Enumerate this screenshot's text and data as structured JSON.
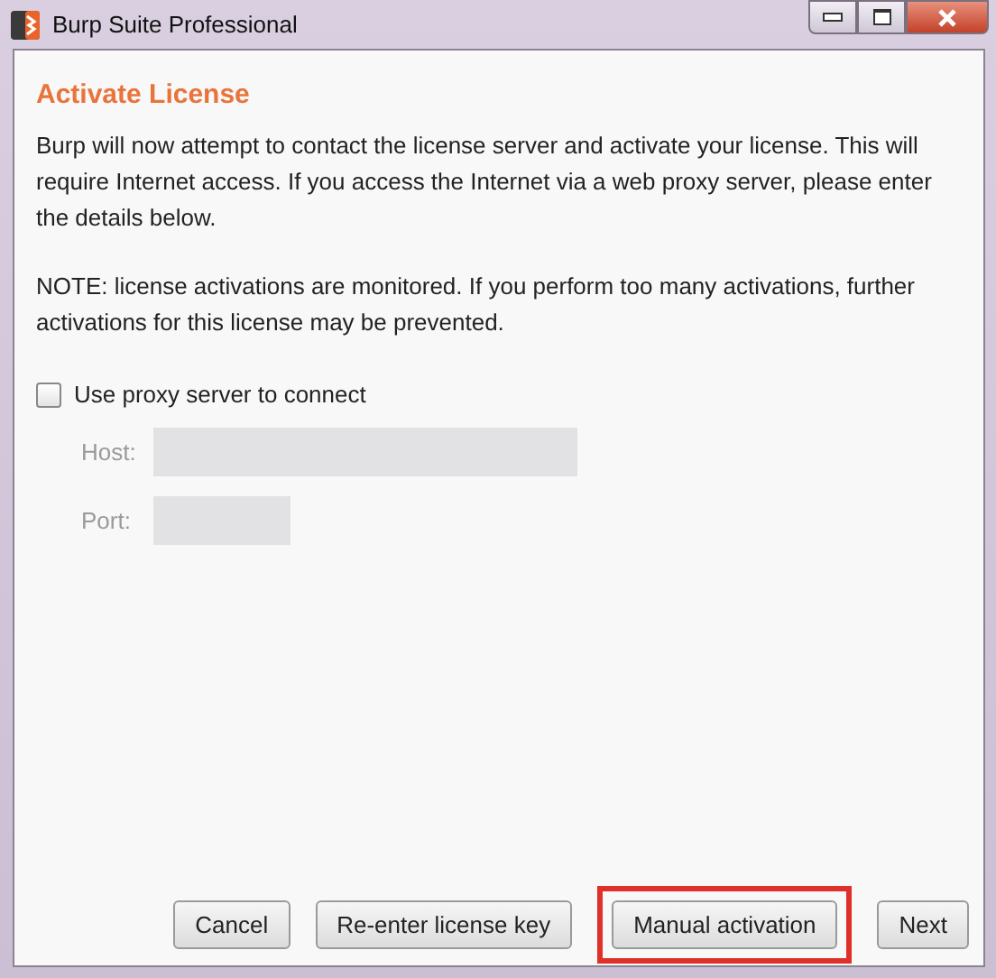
{
  "window": {
    "title": "Burp Suite Professional"
  },
  "heading": "Activate License",
  "paragraphs": [
    "Burp will now attempt to contact the license server and activate your license. This will require Internet access. If you access the Internet via a web proxy server, please enter the details below.",
    "NOTE: license activations are monitored. If you perform too many activations, further activations for this license may be prevented."
  ],
  "proxy_checkbox": {
    "label": "Use proxy server to connect",
    "checked": false
  },
  "fields": [
    {
      "label": "Host:",
      "kind": "wide",
      "disabled": true
    },
    {
      "label": "Port:",
      "kind": "narrow",
      "disabled": true
    }
  ],
  "buttons": [
    {
      "label": "Cancel",
      "highlighted": false
    },
    {
      "label": "Re-enter license key",
      "highlighted": false
    },
    {
      "label": "Manual activation",
      "highlighted": true
    },
    {
      "label": "Next",
      "highlighted": false
    }
  ]
}
